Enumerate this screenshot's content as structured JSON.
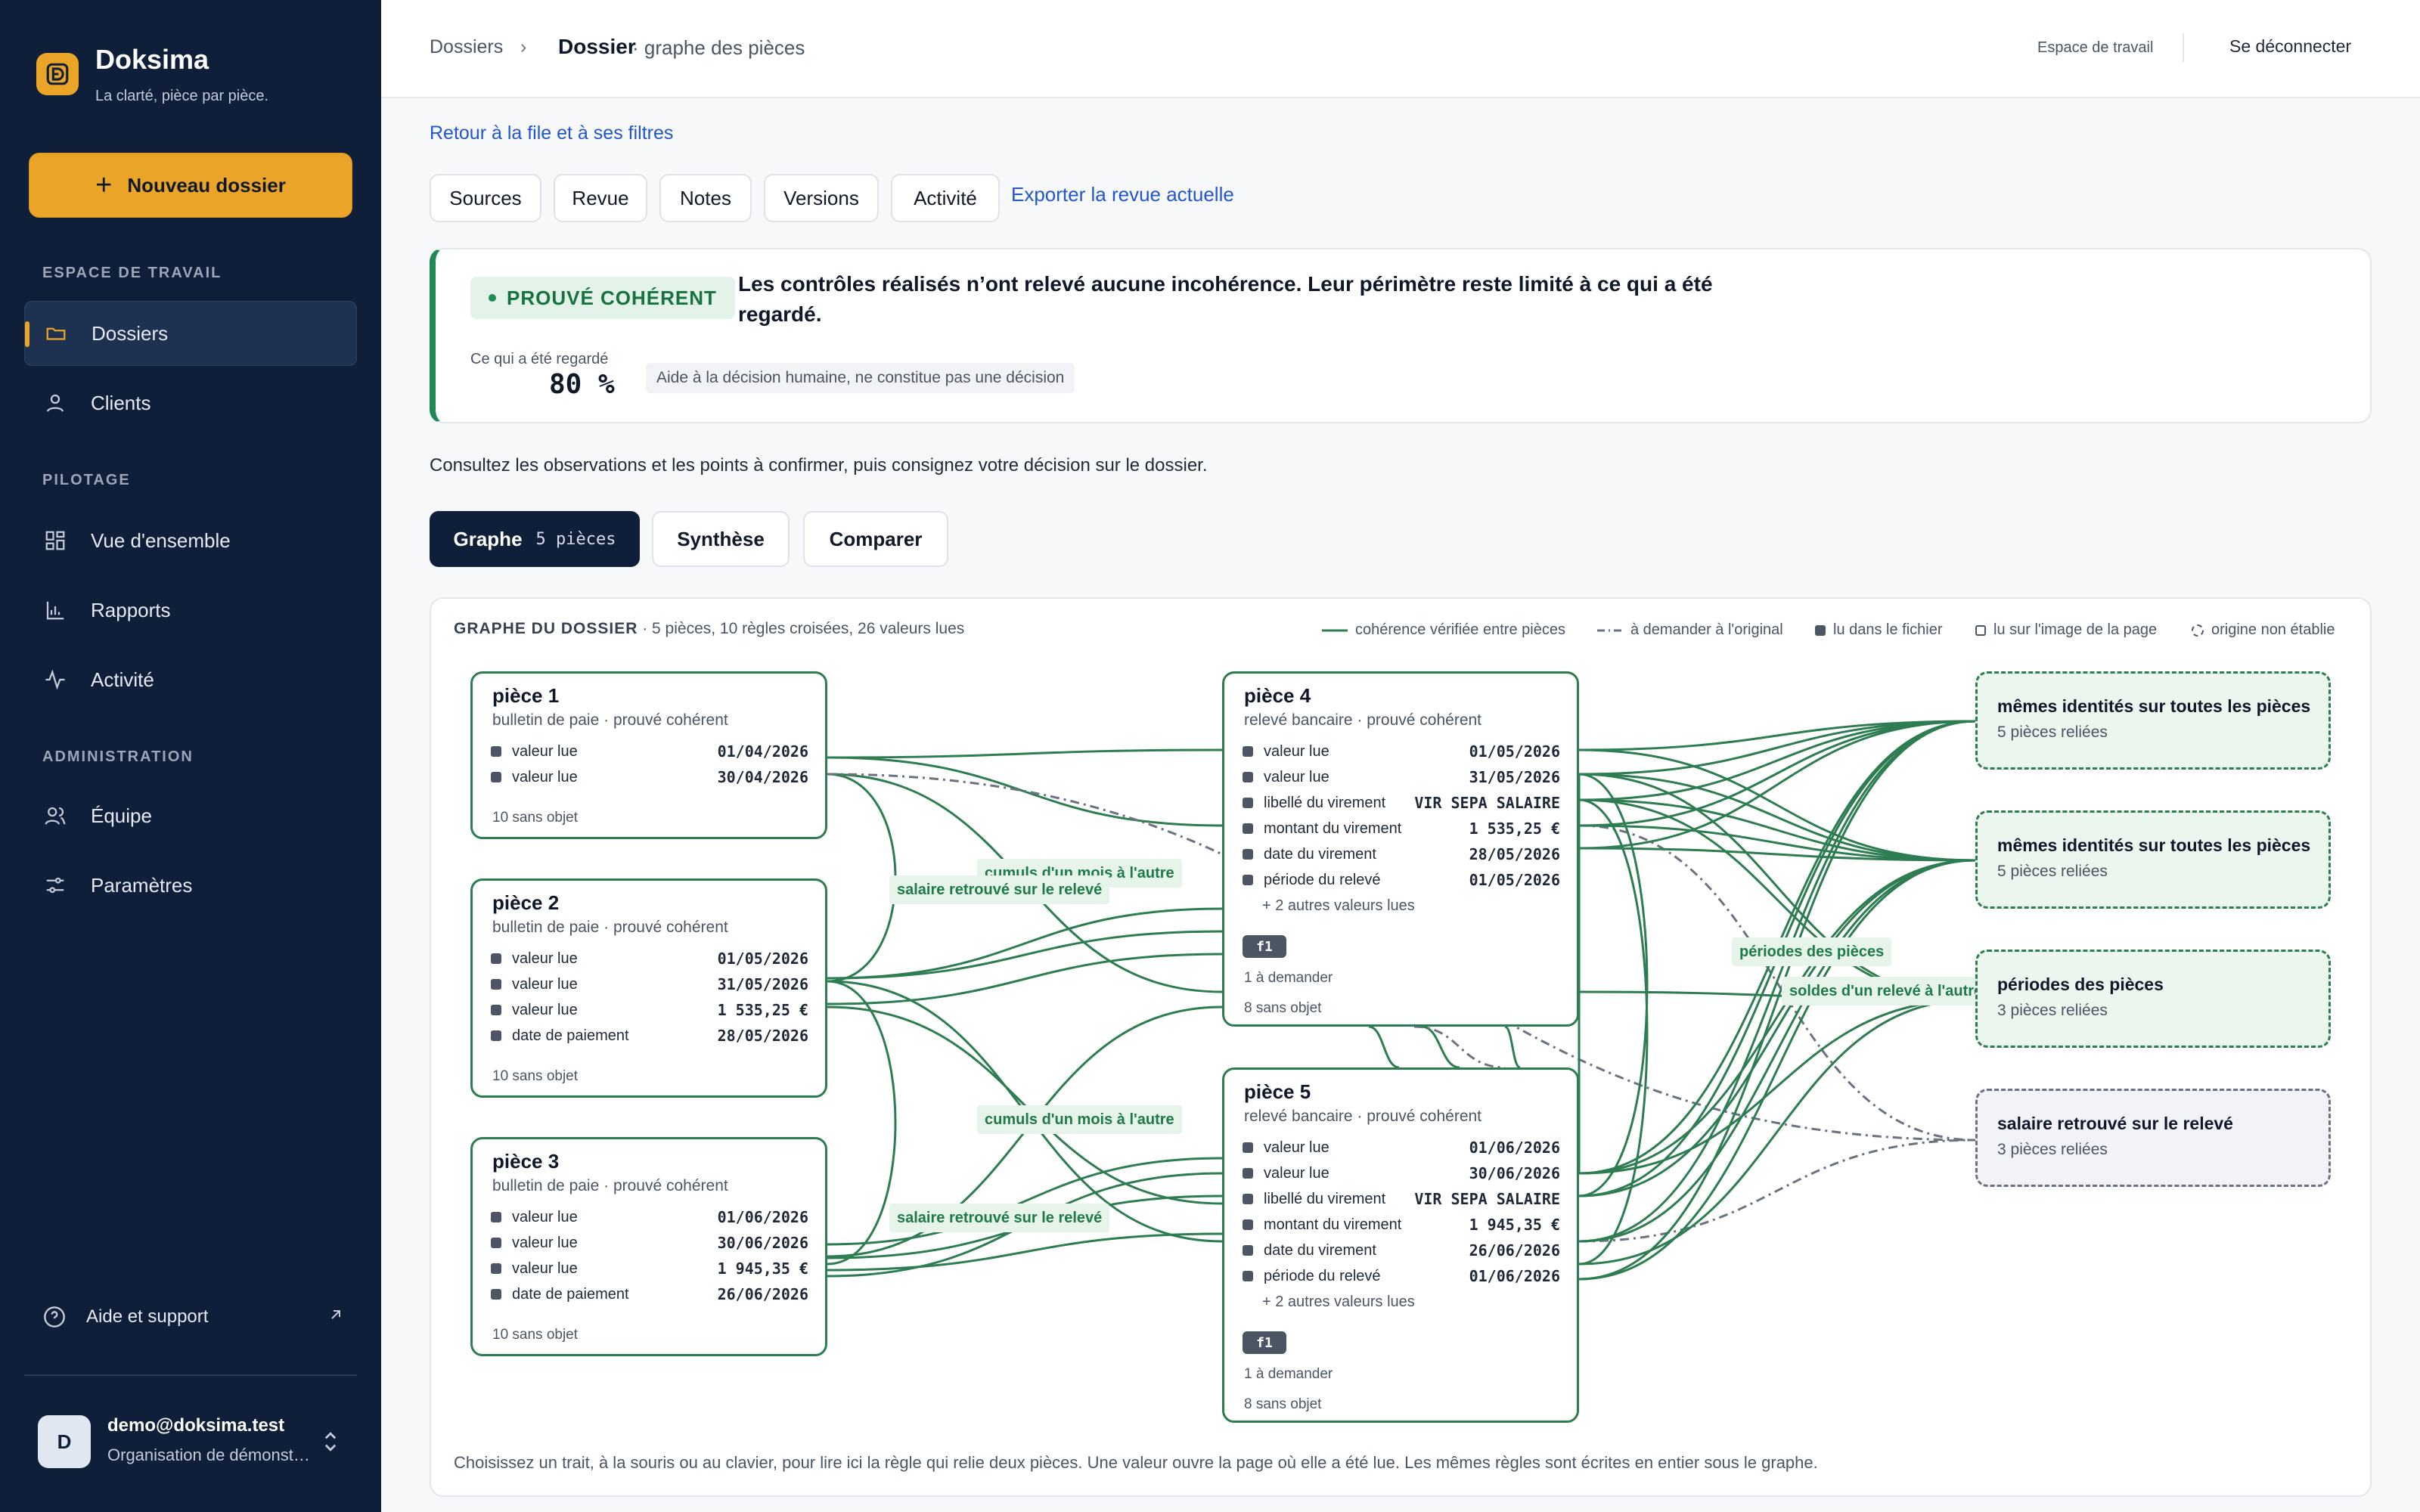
{
  "app": {
    "name": "Doksima",
    "tagline": "La clarté, pièce par pièce.",
    "accent": "#eaa528",
    "sidebar_bg": "#0f1f3a"
  },
  "sidebar": {
    "new_button": "Nouveau dossier",
    "sections": {
      "workspace": "ESPACE DE TRAVAIL",
      "pilotage": "PILOTAGE",
      "admin": "ADMINISTRATION"
    },
    "items": [
      {
        "label": "Dossiers",
        "icon": "folder-icon",
        "active": true
      },
      {
        "label": "Clients",
        "icon": "user-icon"
      },
      {
        "label": "Vue d'ensemble",
        "icon": "grid-icon"
      },
      {
        "label": "Rapports",
        "icon": "bar-chart-icon"
      },
      {
        "label": "Activité",
        "icon": "activity-icon"
      },
      {
        "label": "Équipe",
        "icon": "team-icon"
      },
      {
        "label": "Paramètres",
        "icon": "sliders-icon"
      }
    ],
    "help": "Aide et support",
    "user": {
      "initial": "D",
      "email": "demo@doksima.test",
      "org": "Organisation de démonstration"
    }
  },
  "header": {
    "breadcrumb_root": "Dossiers",
    "breadcrumb_current": "Dossier",
    "breadcrumb_suffix": "· graphe des pièces",
    "workspace_link": "Espace de travail",
    "logout": "Se déconnecter"
  },
  "main": {
    "back_link": "Retour à la file et à ses filtres",
    "tabs": [
      "Sources",
      "Revue",
      "Notes",
      "Versions",
      "Activité"
    ],
    "export_link": "Exporter la revue actuelle",
    "verdict": {
      "badge": "PROUVÉ COHÉRENT",
      "color": "#1f8a55",
      "text": "Les contrôles réalisés n’ont relevé aucune incohérence. Leur périmètre reste limité à ce qui a été regardé.",
      "looked_label": "Ce qui a été regardé",
      "looked_value": "80 %",
      "looked_fraction": 0.8,
      "note": "Aide à la décision humaine, ne constitue pas une décision"
    },
    "instruction": "Consultez les observations et les points à confirmer, puis consignez votre décision sur le dossier.",
    "view_tabs": {
      "graph": "Graphe",
      "graph_count": "5 pièces",
      "synthesis": "Synthèse",
      "compare": "Comparer"
    }
  },
  "graph": {
    "title": "GRAPHE DU DOSSIER",
    "subtitle": "· 5 pièces, 10 règles croisées, 26 valeurs lues",
    "legend": {
      "verified": "cohérence vérifiée entre pièces",
      "to_ask": "à demander à l'original",
      "read_file": "lu dans le fichier",
      "read_image": "lu sur l'image de la page",
      "unknown": "origine non établie"
    },
    "pieces": [
      {
        "title": "pièce 1",
        "subtitle": "bulletin de paie · prouvé cohérent",
        "rows": [
          {
            "label": "valeur lue",
            "value": "01/04/2026"
          },
          {
            "label": "valeur lue",
            "value": "30/04/2026"
          }
        ],
        "footer": "10 sans objet"
      },
      {
        "title": "pièce 2",
        "subtitle": "bulletin de paie · prouvé cohérent",
        "rows": [
          {
            "label": "valeur lue",
            "value": "01/05/2026"
          },
          {
            "label": "valeur lue",
            "value": "31/05/2026"
          },
          {
            "label": "valeur lue",
            "value": "1 535,25 €"
          },
          {
            "label": "date de paiement",
            "value": "28/05/2026"
          }
        ],
        "footer": "10 sans objet"
      },
      {
        "title": "pièce 3",
        "subtitle": "bulletin de paie · prouvé cohérent",
        "rows": [
          {
            "label": "valeur lue",
            "value": "01/06/2026"
          },
          {
            "label": "valeur lue",
            "value": "30/06/2026"
          },
          {
            "label": "valeur lue",
            "value": "1 945,35 €"
          },
          {
            "label": "date de paiement",
            "value": "26/06/2026"
          }
        ],
        "footer": "10 sans objet"
      },
      {
        "title": "pièce 4",
        "subtitle": "relevé bancaire · prouvé cohérent",
        "rows": [
          {
            "label": "valeur lue",
            "value": "01/05/2026"
          },
          {
            "label": "valeur lue",
            "value": "31/05/2026"
          },
          {
            "label": "libellé du virement",
            "value": "VIR SEPA SALAIRE"
          },
          {
            "label": "montant du virement",
            "value": "1 535,25 €"
          },
          {
            "label": "date du virement",
            "value": "28/05/2026"
          },
          {
            "label": "période du relevé",
            "value": "01/05/2026"
          }
        ],
        "more": "+ 2 autres valeurs lues",
        "chip": "f1",
        "ask": "1 à demander",
        "footer": "8 sans objet"
      },
      {
        "title": "pièce 5",
        "subtitle": "relevé bancaire · prouvé cohérent",
        "rows": [
          {
            "label": "valeur lue",
            "value": "01/06/2026"
          },
          {
            "label": "valeur lue",
            "value": "30/06/2026"
          },
          {
            "label": "libellé du virement",
            "value": "VIR SEPA SALAIRE"
          },
          {
            "label": "montant du virement",
            "value": "1 945,35 €"
          },
          {
            "label": "date du virement",
            "value": "26/06/2026"
          },
          {
            "label": "période du relevé",
            "value": "01/06/2026"
          }
        ],
        "more": "+ 2 autres valeurs lues",
        "chip": "f1",
        "ask": "1 à demander",
        "footer": "8 sans objet"
      }
    ],
    "rules": [
      {
        "title": "mêmes identités sur toutes les pièces",
        "sub": "5 pièces reliées"
      },
      {
        "title": "mêmes identités sur toutes les pièces",
        "sub": "5 pièces reliées"
      },
      {
        "title": "périodes des pièces",
        "sub": "3 pièces reliées"
      },
      {
        "title": "salaire retrouvé sur le relevé",
        "sub": "3 pièces reliées"
      }
    ],
    "edge_labels": [
      "cumuls d'un mois à l'autre",
      "salaire retrouvé sur le relevé",
      "cumuls d'un mois à l'autre",
      "salaire retrouvé sur le relevé",
      "périodes des pièces",
      "soldes d'un relevé à l'autre"
    ],
    "footer": "Choisissez un trait, à la souris ou au clavier, pour lire ici la règle qui relie deux pièces. Une valeur ouvre la page où elle a été lue. Les mêmes règles sont écrites en entier sous le graphe."
  }
}
